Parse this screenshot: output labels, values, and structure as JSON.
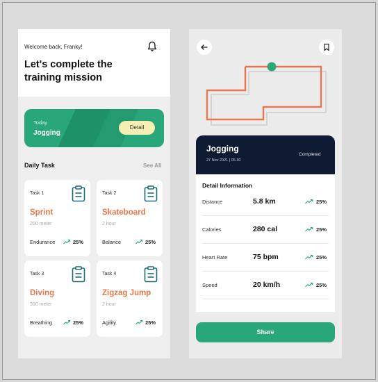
{
  "colors": {
    "accent_green": "#2aa77a",
    "accent_orange": "#e8774b",
    "dark_navy": "#0f1a33",
    "detail_button": "#f6efb3"
  },
  "home": {
    "welcome": "Welcome back, Franky!",
    "headline": "Let's complete the training mission",
    "notification_icon": "bell-icon",
    "today_card": {
      "label": "Today",
      "title": "Jogging",
      "detail_button": "Detail"
    },
    "daily_task": {
      "title": "Daily Task",
      "see_all": "See All",
      "tasks": [
        {
          "num": "Task 1",
          "name": "Sprint",
          "sub": "200 meter",
          "stat": "Endurance",
          "pct": "25%"
        },
        {
          "num": "Task 2",
          "name": "Skateboard",
          "sub": "2 hour",
          "stat": "Balance",
          "pct": "25%"
        },
        {
          "num": "Task 3",
          "name": "Diving",
          "sub": "300 meter",
          "stat": "Breathing",
          "pct": "25%"
        },
        {
          "num": "Task 4",
          "name": "Zigzag Jump",
          "sub": "2 hour",
          "stat": "Agility",
          "pct": "25%"
        }
      ]
    }
  },
  "activity": {
    "back_icon": "arrow-left-icon",
    "bookmark_icon": "bookmark-icon",
    "title": "Jogging",
    "date": "27 Nov 2021 | 05.30",
    "status": "Completed",
    "detail_title": "Detail Information",
    "rows": [
      {
        "label": "Distance",
        "value": "5.8 km",
        "pct": "25%"
      },
      {
        "label": "Calories",
        "value": "280 cal",
        "pct": "25%"
      },
      {
        "label": "Heart Rate",
        "value": "75 bpm",
        "pct": "25%"
      },
      {
        "label": "Speed",
        "value": "20 km/h",
        "pct": "25%"
      }
    ],
    "share_button": "Share"
  }
}
